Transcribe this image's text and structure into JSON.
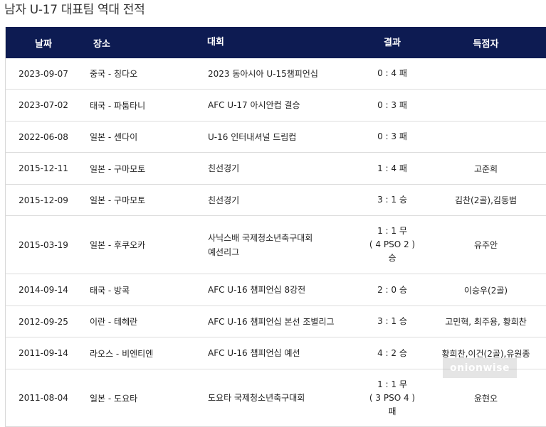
{
  "title": "남자 U-17 대표팀 역대 전적",
  "headers": {
    "date": "날짜",
    "place": "장소",
    "competition": "대회",
    "result": "결과",
    "scorers": "득점자"
  },
  "rows": [
    {
      "date": "2023-09-07",
      "place": "중국 - 칭다오",
      "competition": [
        "2023 동아시아 U-15챔피언십"
      ],
      "result": [
        "0 : 4 패"
      ],
      "scorers": ""
    },
    {
      "date": "2023-07-02",
      "place": "태국 - 파툼타니",
      "competition": [
        "AFC U-17 아시안컵 결승"
      ],
      "result": [
        "0 : 3 패"
      ],
      "scorers": ""
    },
    {
      "date": "2022-06-08",
      "place": "일본 - 센다이",
      "competition": [
        "U-16 인터내셔널 드림컵"
      ],
      "result": [
        "0 : 3 패"
      ],
      "scorers": ""
    },
    {
      "date": "2015-12-11",
      "place": "일본 - 구마모토",
      "competition": [
        "친선경기"
      ],
      "result": [
        "1 : 4 패"
      ],
      "scorers": "고준희"
    },
    {
      "date": "2015-12-09",
      "place": "일본 - 구마모토",
      "competition": [
        "친선경기"
      ],
      "result": [
        "3 : 1 승"
      ],
      "scorers": "김찬(2골),김동범"
    },
    {
      "date": "2015-03-19",
      "place": "일본 - 후쿠오카",
      "competition": [
        "사닉스배 국제청소년축구대회",
        "예선리그"
      ],
      "result": [
        "1 : 1 무",
        "( 4 PSO 2 )",
        "승"
      ],
      "scorers": "유주안"
    },
    {
      "date": "2014-09-14",
      "place": "태국 - 방콕",
      "competition": [
        "AFC U-16 챔피언십 8강전"
      ],
      "result": [
        "2 : 0 승"
      ],
      "scorers": "이승우(2골)"
    },
    {
      "date": "2012-09-25",
      "place": "이란 - 테헤란",
      "competition": [
        "AFC U-16 챔피언십 본선 조별리그"
      ],
      "result": [
        "3 : 1 승"
      ],
      "scorers": "고민혁, 최주용, 황희찬"
    },
    {
      "date": "2011-09-14",
      "place": "라오스 - 비엔티엔",
      "competition": [
        "AFC U-16 챔피언십 예선"
      ],
      "result": [
        "4 : 2 승"
      ],
      "scorers": "황희찬,이건(2골),유원종"
    },
    {
      "date": "2011-08-04",
      "place": "일본 - 도요타",
      "competition": [
        "도요타 국제청소년축구대회"
      ],
      "result": [
        "1 : 1 무",
        "( 3 PSO 4 )",
        "패"
      ],
      "scorers": "윤현오"
    }
  ],
  "watermark": "onionwise"
}
